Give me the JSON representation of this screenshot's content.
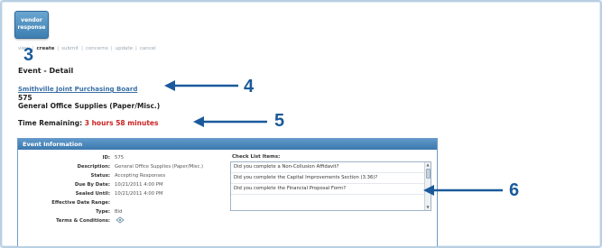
{
  "vendor_button": {
    "line1": "vendor",
    "line2": "response"
  },
  "nav": [
    {
      "label": "view",
      "active": false
    },
    {
      "label": "create",
      "active": true
    },
    {
      "label": "submit",
      "active": false
    },
    {
      "label": "concerns",
      "active": false
    },
    {
      "label": "update",
      "active": false
    },
    {
      "label": "cancel",
      "active": false
    }
  ],
  "callouts": {
    "c3": "3",
    "c4": "4",
    "c5": "5",
    "c6": "6"
  },
  "page_title": "Event - Detail",
  "org_link": "Smithville Joint Purchasing Board",
  "event_id": "575",
  "event_name": "General Office Supplies (Paper/Misc.)",
  "time_remaining": {
    "label": "Time Remaining:",
    "value": "3 hours 58 minutes"
  },
  "panel": {
    "title": "Event Information",
    "rows": [
      {
        "label": "ID:",
        "value": "575"
      },
      {
        "label": "Description:",
        "value": "General Office Supplies (Paper/Misc.)"
      },
      {
        "label": "Status:",
        "value": "Accepting Responses"
      },
      {
        "label": "Due By Date:",
        "value": "10/21/2011 4:00 PM"
      },
      {
        "label": "Sealed Until:",
        "value": "10/21/2011 4:00 PM"
      },
      {
        "label": "Effective Date Range:",
        "value": ""
      },
      {
        "label": "Type:",
        "value": "Bid"
      },
      {
        "label": "Terms & Conditions:",
        "value": ""
      }
    ],
    "checklist_label": "Check List Items:",
    "checklist_items": [
      "Did you complete a Non-Collusion Affidavit?",
      "Did you complete the Capital Improvements Section (3.36)?",
      "Did you complete the Financial Proposal Form?"
    ],
    "terms_icon": "attachment-icon"
  },
  "colors": {
    "accent": "#3b78ad",
    "callout": "#1a5a9c",
    "alert": "#cc2222"
  }
}
